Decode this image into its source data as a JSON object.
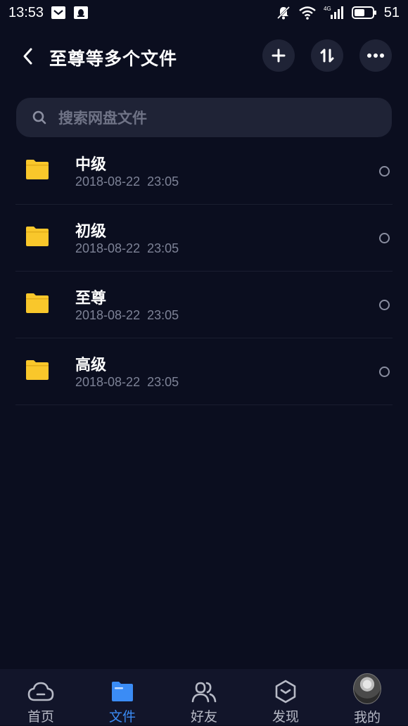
{
  "status_bar": {
    "time": "13:53",
    "network_label": "4G",
    "battery": "51"
  },
  "header": {
    "title": "至尊等多个文件"
  },
  "search": {
    "placeholder": "搜索网盘文件"
  },
  "files": [
    {
      "name": "中级",
      "date": "2018-08-22  23:05"
    },
    {
      "name": "初级",
      "date": "2018-08-22  23:05"
    },
    {
      "name": "至尊",
      "date": "2018-08-22  23:05"
    },
    {
      "name": "高级",
      "date": "2018-08-22  23:05"
    }
  ],
  "bottom_nav": {
    "items": [
      {
        "label": "首页",
        "icon": "cloud-icon"
      },
      {
        "label": "文件",
        "icon": "folder-icon",
        "active": true
      },
      {
        "label": "好友",
        "icon": "friends-icon"
      },
      {
        "label": "发现",
        "icon": "discover-icon"
      },
      {
        "label": "我的",
        "icon": "avatar"
      }
    ]
  },
  "colors": {
    "background": "#0b0e1f",
    "folder": "#f9c72b",
    "accent": "#3b8cf5"
  }
}
